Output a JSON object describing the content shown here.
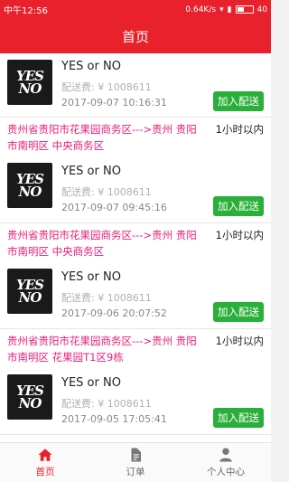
{
  "statusbar": {
    "time": "中午12:56",
    "speed": "0.64K/s",
    "battery": "40",
    "battery_level": 0.4
  },
  "header": {
    "title": "首页"
  },
  "orders": [
    {
      "route": "",
      "duration": "",
      "product": "YES or NO",
      "fee": "配送费: ¥ 1008611",
      "date": "2017-09-07 10:16:31",
      "button": "加入配送"
    },
    {
      "route": "贵州省贵阳市花果园商务区--->贵州 贵阳市南明区 中央商务区",
      "duration": "1小时以内",
      "product": "YES or NO",
      "fee": "配送费: ¥ 1008611",
      "date": "2017-09-07 09:45:16",
      "button": "加入配送"
    },
    {
      "route": "贵州省贵阳市花果园商务区--->贵州 贵阳市南明区 中央商务区",
      "duration": "1小时以内",
      "product": "YES or NO",
      "fee": "配送费: ¥ 1008611",
      "date": "2017-09-06 20:07:52",
      "button": "加入配送"
    },
    {
      "route": "贵州省贵阳市花果园商务区--->贵州 贵阳市南明区 花果园T1区9栋",
      "duration": "1小时以内",
      "product": "YES or NO",
      "fee": "配送费: ¥ 1008611",
      "date": "2017-09-05 17:05:41",
      "button": "加入配送"
    }
  ],
  "logo": {
    "line1": "YES",
    "line2": "NO"
  },
  "tabs": [
    {
      "label": "首页",
      "icon": "home-icon"
    },
    {
      "label": "订单",
      "icon": "document-icon"
    },
    {
      "label": "个人中心",
      "icon": "person-icon"
    }
  ],
  "colors": {
    "primary": "#e8212c",
    "route": "#e8217a",
    "button": "#2aaf3a"
  }
}
